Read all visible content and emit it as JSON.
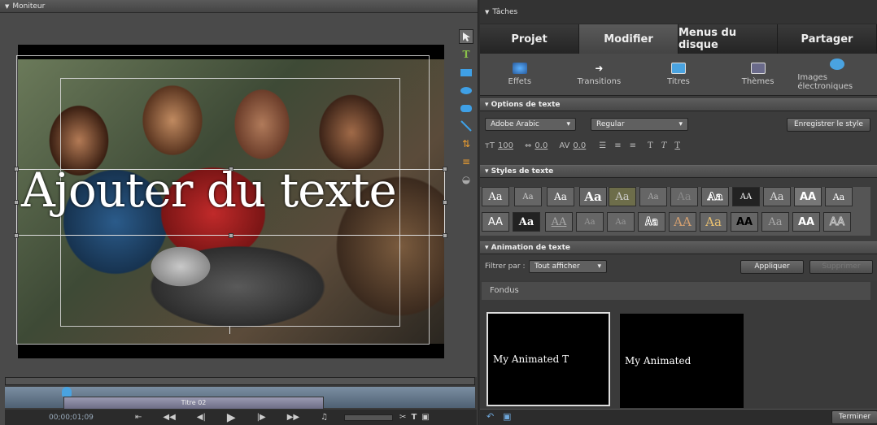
{
  "monitor": {
    "title": "Moniteur",
    "overlay_text": "Ajouter du texte",
    "clip_label": "Titre 02",
    "timecode": "00;00;01;09"
  },
  "tasks": {
    "title": "Tâches",
    "tabs": [
      "Projet",
      "Modifier",
      "Menus du disque",
      "Partager"
    ],
    "active_tab": "Modifier",
    "subtabs": [
      "Effets",
      "Transitions",
      "Titres",
      "Thèmes",
      "Images électroniques"
    ],
    "text_options": {
      "heading": "Options de texte",
      "font": "Adobe Arabic",
      "style": "Regular",
      "save_style": "Enregistrer le style",
      "size": "100",
      "kerning": "0.0",
      "leading": "0.0"
    },
    "text_styles": {
      "heading": "Styles de texte",
      "row1": [
        "Aa",
        "Aa",
        "Aa",
        "Aa",
        "Aa",
        "Aa",
        "Aa",
        "Aa",
        "AA",
        "Aa",
        "AA",
        "Aa"
      ],
      "row2": [
        "AA",
        "Aa",
        "AA",
        "Aa",
        "Aa",
        "Aa",
        "AA",
        "Aa",
        "AA",
        "Aa",
        "AA",
        "AA"
      ]
    },
    "animation": {
      "heading": "Animation de texte",
      "filter_label": "Filtrer par :",
      "filter_value": "Tout afficher",
      "apply": "Appliquer",
      "delete": "Supprimer",
      "category": "Fondus",
      "thumbs": [
        "My Animated T",
        "My Animated"
      ]
    },
    "done": "Terminer"
  },
  "colors": {
    "accent": "#4aa3e0",
    "selection": "#ffffff"
  }
}
